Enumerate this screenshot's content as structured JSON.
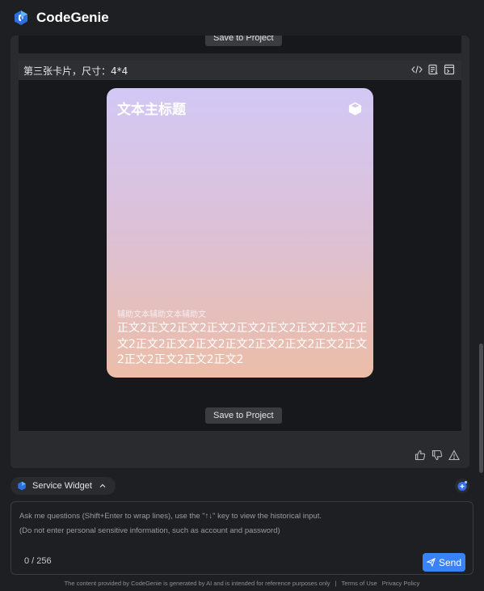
{
  "app": {
    "title": "CodeGenie"
  },
  "previous_card": {
    "save_label": "Save to Project"
  },
  "card": {
    "header_title": "第三张卡片，尺寸：4*4",
    "preview": {
      "title": "文本主标题",
      "aux_text": "辅助文本辅助文本辅助文",
      "body_text": "正文2正文2正文2正文2正文2正文2正文2正文2正文2正文2正文2正文2正文2正文2正文2正文2正文2正文2正文2正文2正文2",
      "gradient": [
        "#d2c8f5",
        "#dcc1d6",
        "#ecbda7"
      ]
    },
    "save_label": "Save to Project",
    "actions": [
      "code-icon",
      "document-icon",
      "preview-icon"
    ]
  },
  "feedback": [
    "thumbs-up-icon",
    "thumbs-down-icon",
    "warning-icon"
  ],
  "composer": {
    "widget_label": "Service Widget",
    "placeholder_line1": "Ask me questions (Shift+Enter to wrap lines), use the \"↑↓\" key to view the historical input.",
    "placeholder_line2": "(Do not enter personal sensitive information, such as account and password)",
    "counter": "0 / 256",
    "send_label": "Send"
  },
  "footer": {
    "disclaimer": "The content provided by CodeGenie is generated by AI and is intended for reference purposes only",
    "separator": "|",
    "terms": "Terms of Use",
    "privacy": "Privacy Policy"
  },
  "colors": {
    "accent": "#3a82f7",
    "background": "#1e1f22",
    "panel": "#2a2b2e"
  }
}
